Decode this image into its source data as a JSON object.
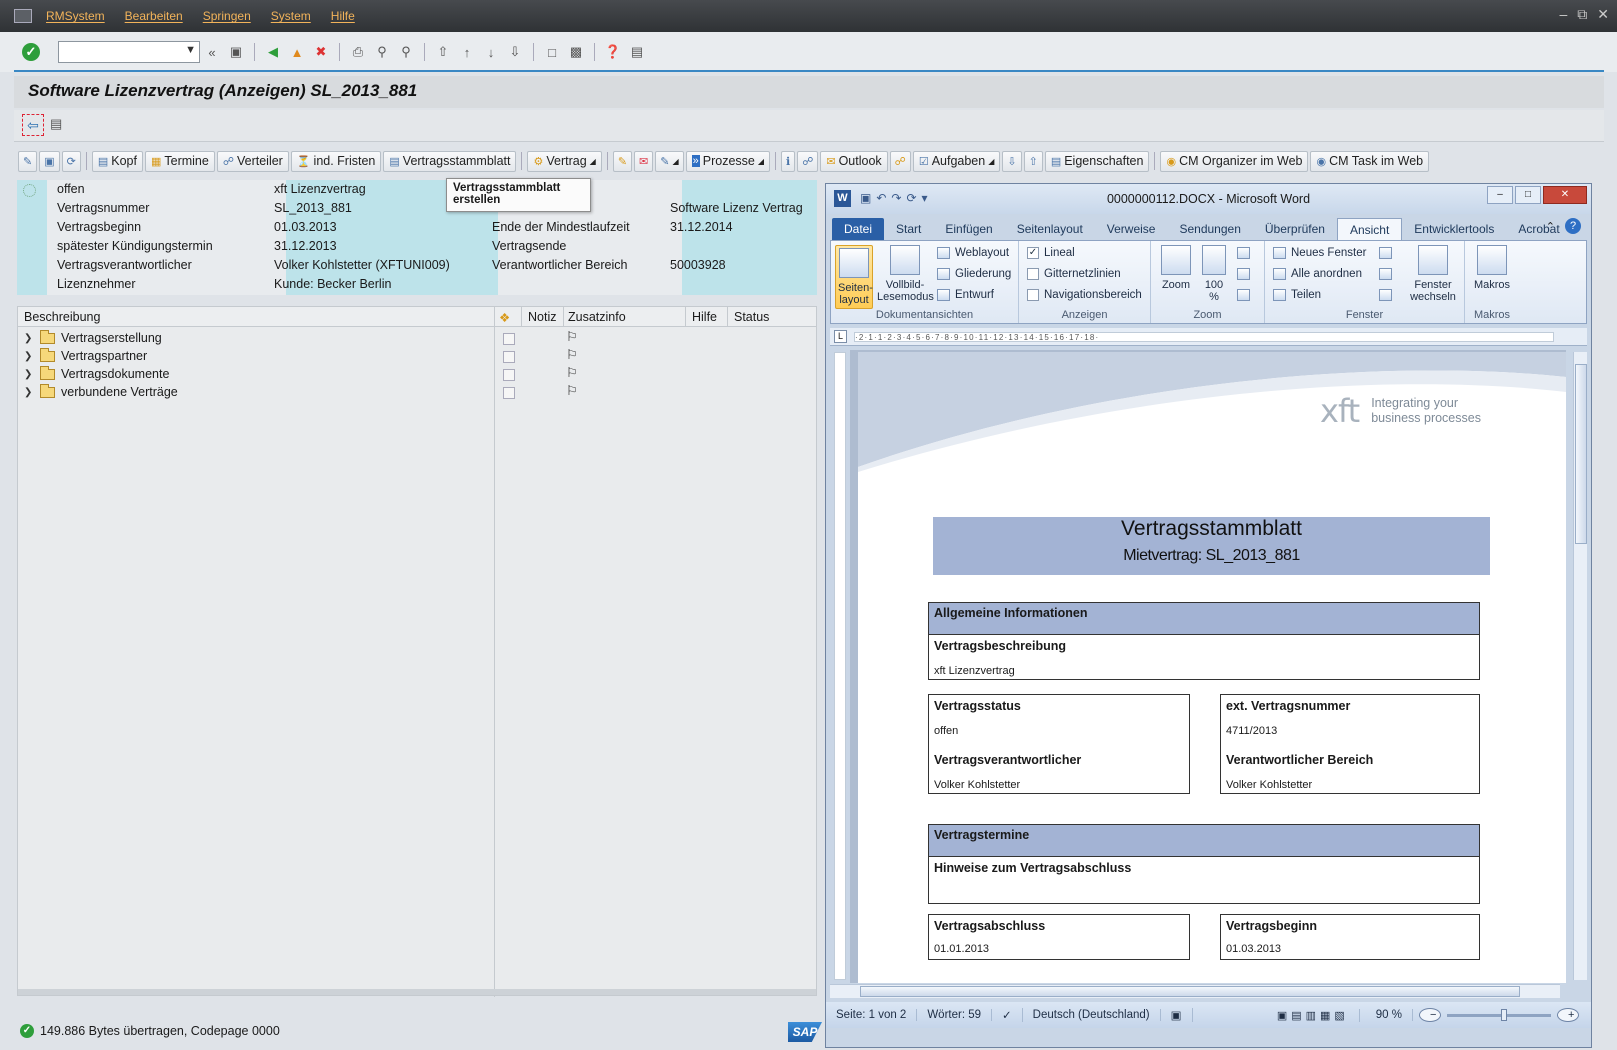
{
  "menubar": {
    "items": [
      "RMSystem",
      "Bearbeiten",
      "Springen",
      "System",
      "Hilfe"
    ]
  },
  "title": "Software Lizenzvertrag (Anzeigen) SL_2013_881",
  "apptoolbar": {
    "kopf": "Kopf",
    "termine": "Termine",
    "verteiler": "Verteiler",
    "fristen": "ind. Fristen",
    "stammblatt": "Vertragsstammblatt",
    "vertrag": "Vertrag",
    "prozesse": "Prozesse",
    "outlook": "Outlook",
    "aufgaben": "Aufgaben",
    "eigenschaften": "Eigenschaften",
    "cm_organizer": "CM Organizer im Web",
    "cm_task": "CM Task im Web"
  },
  "tooltip": "Vertragsstammblatt erstellen",
  "header": {
    "status_label": "offen",
    "description_value": "xft Lizenzvertrag",
    "rows": [
      {
        "label": "Vertragsnummer",
        "value": "SL_2013_881",
        "label2": "",
        "value2": "Software Lizenz Vertrag"
      },
      {
        "label": "Vertragsbeginn",
        "value": "01.03.2013",
        "label2": "Ende der Mindestlaufzeit",
        "value2": "31.12.2014"
      },
      {
        "label": "spätester Kündigungstermin",
        "value": "31.12.2013",
        "label2": "Vertragsende",
        "value2": ""
      },
      {
        "label": "Vertragsverantwortlicher",
        "value": "Volker Kohlstetter (XFTUNI009)",
        "label2": "Verantwortlicher Bereich",
        "value2": "50003928"
      },
      {
        "label": "Lizenznehmer",
        "value": "Kunde: Becker Berlin",
        "label2": "",
        "value2": ""
      }
    ]
  },
  "tree": {
    "columns": {
      "beschreibung": "Beschreibung",
      "notiz": "Notiz",
      "zusatzinfo": "Zusatzinfo",
      "hilfe": "Hilfe",
      "status": "Status"
    },
    "items": [
      "Vertragserstellung",
      "Vertragspartner",
      "Vertragsdokumente",
      "verbundene Verträge"
    ]
  },
  "statusbar": "149.886 Bytes übertragen, Codepage 0000",
  "saplogo": "SAP",
  "word": {
    "title": "0000000112.DOCX - Microsoft Word",
    "tabs": [
      "Datei",
      "Start",
      "Einfügen",
      "Seitenlayout",
      "Verweise",
      "Sendungen",
      "Überprüfen",
      "Ansicht",
      "Entwicklertools",
      "Acrobat"
    ],
    "active_tab": "Ansicht",
    "ribbon": {
      "seitenlayout": "Seiten-\nlayout",
      "vollbild": "Vollbild-\nLesemodus",
      "weblayout": "Weblayout",
      "gliederung": "Gliederung",
      "entwurf": "Entwurf",
      "grp_dokumentansichten": "Dokumentansichten",
      "lineal": "Lineal",
      "gitternetzlinien": "Gitternetzlinien",
      "navigationsbereich": "Navigationsbereich",
      "grp_anzeigen": "Anzeigen",
      "zoom": "Zoom",
      "zoom100": "100\n%",
      "grp_zoom": "Zoom",
      "neues_fenster": "Neues Fenster",
      "alle_anordnen": "Alle anordnen",
      "teilen": "Teilen",
      "fenster_wechseln": "Fenster\nwechseln",
      "grp_fenster": "Fenster",
      "makros": "Makros",
      "grp_makros": "Makros"
    },
    "ruler_text": "·2·1·1·2·3·4·5·6·7·8·9·10·11·12·13·14·15·16·17·18·",
    "doc": {
      "logo_text": "xft",
      "logo_tag_1": "Integrating your",
      "logo_tag_2": "business processes",
      "heading": "Vertragsstammblatt",
      "subheading": "Mietvertrag: SL_2013_881",
      "sec1_title": "Allgemeine Informationen",
      "beschreibung_label": "Vertragsbeschreibung",
      "beschreibung_value": "xft Lizenzvertrag",
      "status_label": "Vertragsstatus",
      "status_value": "offen",
      "ext_label": "ext. Vertragsnummer",
      "ext_value": "4711/2013",
      "verantw_label": "Vertragsverantwortlicher",
      "verantw_value": "Volker Kohlstetter",
      "bereich_label": "Verantwortlicher Bereich",
      "bereich_value": "Volker Kohlstetter",
      "sec2_title": "Vertragstermine",
      "hinweise_label": "Hinweise zum Vertragsabschluss",
      "abschluss_label": "Vertragsabschluss",
      "abschluss_value": "01.01.2013",
      "beginn_label": "Vertragsbeginn",
      "beginn_value": "01.03.2013"
    },
    "status": {
      "seite": "Seite: 1 von 2",
      "woerter": "Wörter: 59",
      "sprache": "Deutsch (Deutschland)",
      "zoom": "90 %"
    }
  }
}
